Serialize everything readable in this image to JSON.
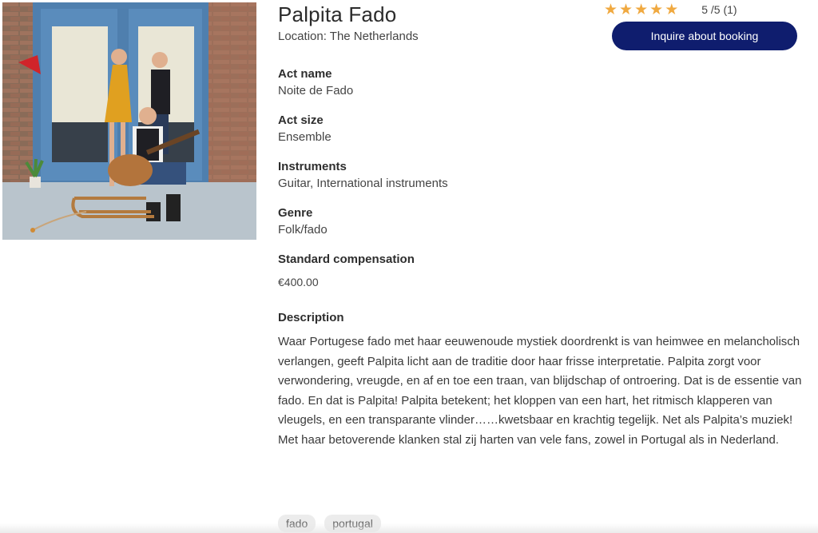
{
  "act": {
    "title": "Palpita Fado",
    "location": "Location: The Netherlands",
    "photo_icon": "band-photo"
  },
  "rating": {
    "stars": 5,
    "max": 5,
    "star_glyph": "★",
    "text": "5 /5 (1)",
    "star_color": "#f0a940"
  },
  "actions": {
    "inquire_label": "Inquire about booking",
    "inquire_color": "#0f1d6e"
  },
  "details": {
    "act_name_label": "Act name",
    "act_name": "Noite de Fado",
    "act_size_label": "Act size",
    "act_size": "Ensemble",
    "instruments_label": "Instruments",
    "instruments": "Guitar, International instruments",
    "genre_label": "Genre",
    "genre": "Folk/fado",
    "compensation_label": "Standard compensation",
    "compensation": "€400.00",
    "description_label": "Description",
    "description": "Waar Portugese fado met haar eeuwenoude mystiek doordrenkt is van heimwee en melancholisch verlangen, geeft Palpita licht aan de traditie door haar frisse interpretatie. Palpita zorgt voor verwondering, vreugde, en af en toe een traan, van blijdschap of ontroering. Dat is de essentie van fado. En dat is Palpita! Palpita betekent; het kloppen van een hart, het ritmisch klapperen van vleugels, en een transparante vlinder……kwetsbaar en krachtig tegelijk. Net als Palpita’s muziek! Met haar betoverende klanken stal zij harten van vele fans, zowel in Portugal als in Nederland."
  },
  "tags": [
    "fado",
    "portugal"
  ]
}
